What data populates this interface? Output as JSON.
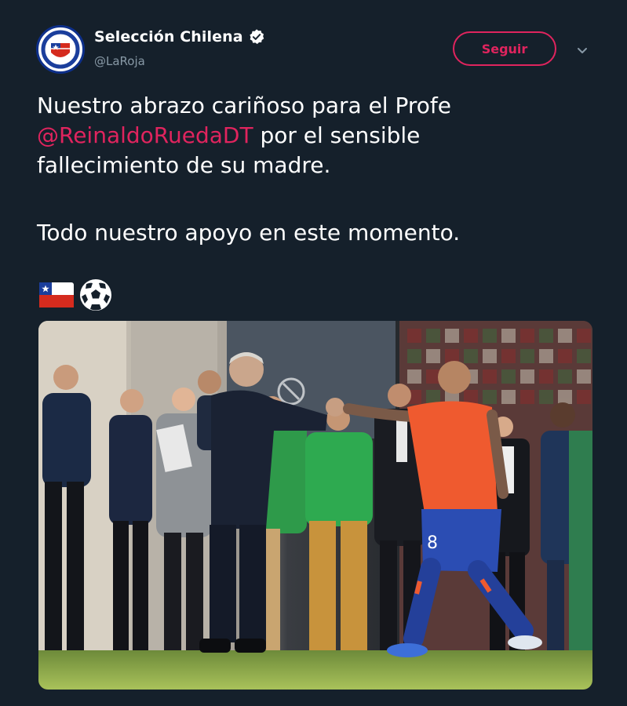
{
  "account": {
    "display_name": "Selección Chilena",
    "handle": "@LaRoja",
    "avatar_icon": "chile-football-crest-icon",
    "verified_icon": "verified-badge-icon"
  },
  "actions": {
    "follow_label": "Seguir",
    "more_icon": "chevron-down-icon"
  },
  "tweet": {
    "line1_text": "Nuestro abrazo cariñoso para el Profe",
    "mention": "@ReinaldoRuedaDT",
    "line2_rest": " por el sensible",
    "line3_text": "fallecimiento de su madre.",
    "line4_text": "Todo nuestro apoyo en este momento.",
    "emojis": [
      "chile-flag-icon",
      "soccer-ball-icon"
    ]
  },
  "media": {
    "description_icon": "photo-handshake-players"
  },
  "colors": {
    "background": "#15202b",
    "accent": "#e0245e",
    "secondary_text": "#8899a6"
  }
}
